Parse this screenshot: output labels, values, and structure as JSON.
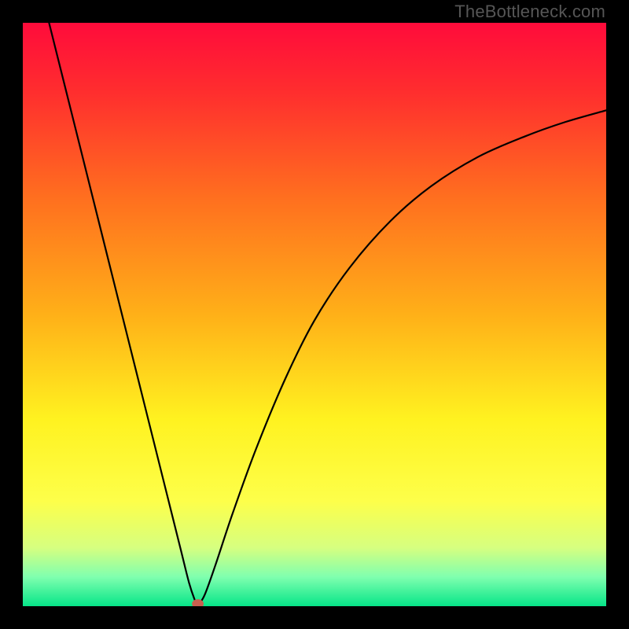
{
  "watermark": "TheBottleneck.com",
  "chart_data": {
    "type": "line",
    "title": "",
    "xlabel": "",
    "ylabel": "",
    "xlim": [
      0,
      1
    ],
    "ylim": [
      0,
      1
    ],
    "background_gradient": {
      "stops": [
        {
          "offset": 0.0,
          "color": "#ff0b3b"
        },
        {
          "offset": 0.12,
          "color": "#ff2e2e"
        },
        {
          "offset": 0.3,
          "color": "#ff6f1f"
        },
        {
          "offset": 0.5,
          "color": "#ffb018"
        },
        {
          "offset": 0.68,
          "color": "#fff220"
        },
        {
          "offset": 0.82,
          "color": "#fdff4a"
        },
        {
          "offset": 0.9,
          "color": "#d6ff80"
        },
        {
          "offset": 0.95,
          "color": "#7fffaf"
        },
        {
          "offset": 1.0,
          "color": "#06e588"
        }
      ]
    },
    "series": [
      {
        "name": "left-branch",
        "comment": "near-linear descent from top-left to the minimum",
        "points": [
          {
            "x": 0.045,
            "y": 1.0
          },
          {
            "x": 0.07,
            "y": 0.9
          },
          {
            "x": 0.095,
            "y": 0.8
          },
          {
            "x": 0.12,
            "y": 0.7
          },
          {
            "x": 0.145,
            "y": 0.6
          },
          {
            "x": 0.17,
            "y": 0.5
          },
          {
            "x": 0.195,
            "y": 0.4
          },
          {
            "x": 0.22,
            "y": 0.3
          },
          {
            "x": 0.245,
            "y": 0.2
          },
          {
            "x": 0.27,
            "y": 0.1
          },
          {
            "x": 0.285,
            "y": 0.04
          },
          {
            "x": 0.295,
            "y": 0.01
          },
          {
            "x": 0.3,
            "y": 0.0
          }
        ]
      },
      {
        "name": "right-branch",
        "comment": "concave rise from the minimum toward upper-right",
        "points": [
          {
            "x": 0.3,
            "y": 0.0
          },
          {
            "x": 0.312,
            "y": 0.02
          },
          {
            "x": 0.33,
            "y": 0.07
          },
          {
            "x": 0.36,
            "y": 0.16
          },
          {
            "x": 0.4,
            "y": 0.27
          },
          {
            "x": 0.45,
            "y": 0.39
          },
          {
            "x": 0.5,
            "y": 0.49
          },
          {
            "x": 0.56,
            "y": 0.58
          },
          {
            "x": 0.63,
            "y": 0.66
          },
          {
            "x": 0.7,
            "y": 0.72
          },
          {
            "x": 0.78,
            "y": 0.77
          },
          {
            "x": 0.86,
            "y": 0.805
          },
          {
            "x": 0.93,
            "y": 0.83
          },
          {
            "x": 1.0,
            "y": 0.85
          }
        ]
      }
    ],
    "marker": {
      "name": "min-point",
      "x": 0.3,
      "y": 0.004,
      "rx": 0.01,
      "ry": 0.008,
      "color": "#c86050"
    }
  }
}
